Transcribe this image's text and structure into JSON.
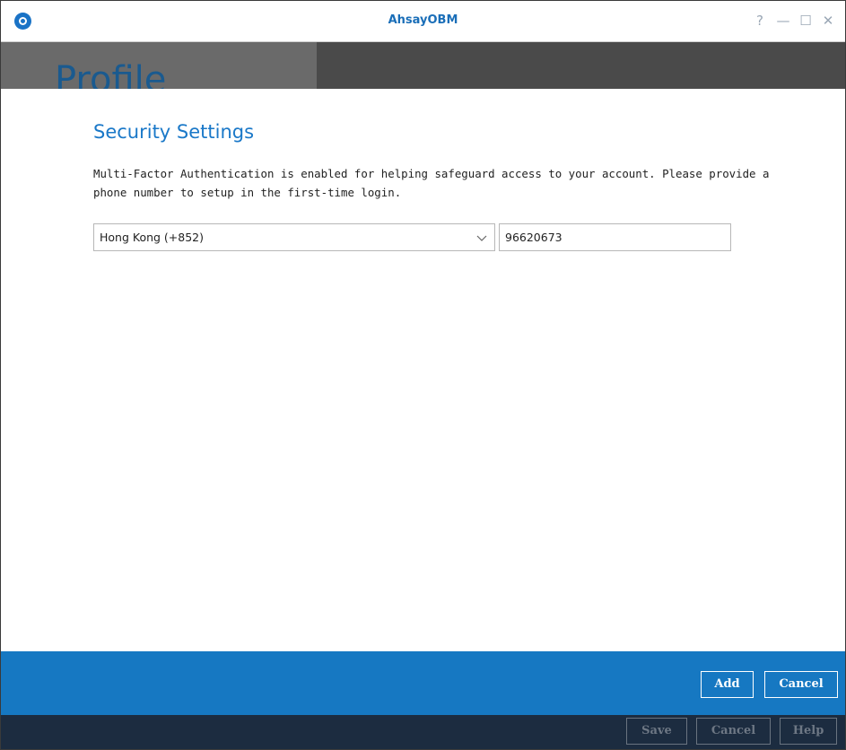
{
  "window": {
    "title": "AhsayOBM",
    "controls": {
      "help": "?",
      "minimize": "—",
      "maximize": "☐",
      "close": "✕"
    }
  },
  "header": {
    "page_title": "Profile"
  },
  "main": {
    "section_title": "Security Settings",
    "description": "Multi-Factor Authentication is enabled for helping safeguard access to your account. Please provide a phone number to setup in the first-time login.",
    "country_select": {
      "selected": "Hong Kong (+852)"
    },
    "phone_input": {
      "value": "96620673"
    }
  },
  "action_bar": {
    "add_label": "Add",
    "cancel_label": "Cancel"
  },
  "footer": {
    "save_label": "Save",
    "cancel_label": "Cancel",
    "help_label": "Help"
  },
  "colors": {
    "accent": "#1678c2",
    "title_blue": "#1a6eb8",
    "footer_bg": "#1c2c40",
    "header_band": "#4a4a4a"
  },
  "icons": {
    "app_logo": "app-logo-icon",
    "select_chevron": "chevron-down-icon"
  }
}
